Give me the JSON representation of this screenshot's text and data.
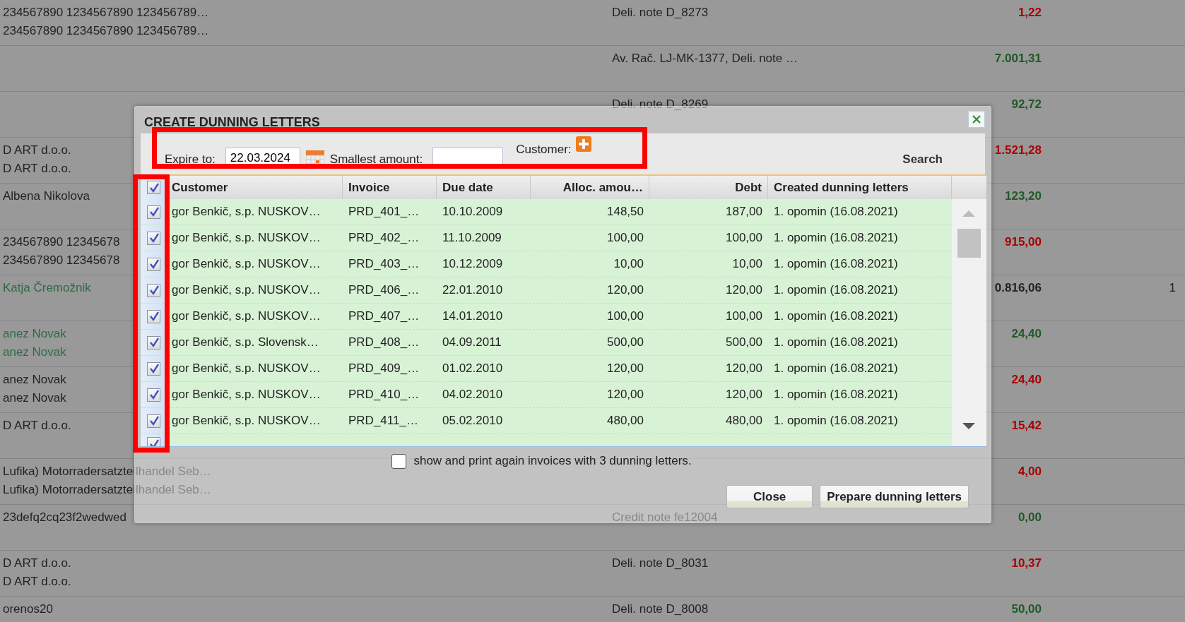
{
  "background": {
    "rows": [
      {
        "names": [
          "234567890 1234567890 123456789…",
          "234567890 1234567890 123456789…"
        ],
        "linked": false,
        "document": "Deli. note D_8273",
        "amount": "1,22",
        "color": "#a80000"
      },
      {
        "names": [],
        "document": "Av. Rač. LJ-MK-1377, Deli. note …",
        "amount": "7.001,31",
        "color": "#1f5a26"
      },
      {
        "names": [],
        "document": "Deli. note D_8269",
        "amount": "92,72",
        "color": "#1f5a26"
      },
      {
        "names": [
          "D ART d.o.o.",
          "D ART d.o.o."
        ],
        "linked": false,
        "amount": "1.521,28",
        "color": "#a80000"
      },
      {
        "names": [
          "Albena Nikolova"
        ],
        "linked": false,
        "amount": "123,20",
        "color": "#1f5a26"
      },
      {
        "names": [
          "234567890 12345678",
          "234567890 12345678"
        ],
        "linked": false,
        "amount": "915,00",
        "color": "#a80000"
      },
      {
        "names": [
          "Katja Čremožnik"
        ],
        "linked": true,
        "amount": "0.816,06",
        "color": "#222222",
        "extra": "1"
      },
      {
        "names": [
          "anez Novak",
          "anez Novak"
        ],
        "linked": true,
        "amount": "24,40",
        "color": "#1f5a26"
      },
      {
        "names": [
          "anez Novak",
          "anez Novak"
        ],
        "linked": false,
        "amount": "24,40",
        "color": "#a80000"
      },
      {
        "names": [
          "D ART d.o.o."
        ],
        "linked": false,
        "amount": "15,42",
        "color": "#a80000"
      },
      {
        "names": [
          "Lufika) Motorradersatzteilhandel Seb…",
          "Lufika) Motorradersatzteilhandel Seb…"
        ],
        "linked": false,
        "amount": "4,00",
        "color": "#a80000"
      },
      {
        "names": [
          "23defq2cq23f2wedwed"
        ],
        "linked": false,
        "document": "Credit note fe12004",
        "amount": "0,00",
        "color": "#1f5a26"
      },
      {
        "names": [
          "D ART d.o.o.",
          "D ART d.o.o."
        ],
        "linked": false,
        "document": "Deli. note D_8031",
        "amount": "10,37",
        "color": "#a80000"
      },
      {
        "names": [
          "orenos20"
        ],
        "linked": false,
        "document": "Deli. note D_8008",
        "amount": "50,00",
        "color": "#1f5a26"
      }
    ]
  },
  "modal": {
    "title": "CREATE DUNNING LETTERS",
    "filters": {
      "expire_label": "Expire to:",
      "expire_value": "22.03.2024",
      "amount_label": "Smallest amount:",
      "customer_label": "Customer:",
      "search_label": "Search",
      "highlighted": true
    },
    "table": {
      "all_checked": true,
      "checkbox_column_highlighted": true,
      "columns": [
        "Customer",
        "Invoice",
        "Due date",
        "Alloc. amou…",
        "Debt",
        "Created dunning letters"
      ],
      "rows": [
        {
          "checked": true,
          "cells": [
            "gor Benkič, s.p. NUSKOV…",
            "PRD_401_…",
            "10.10.2009",
            "148,50",
            "187,00",
            "1. opomin (16.08.2021)"
          ]
        },
        {
          "checked": true,
          "cells": [
            "gor Benkič, s.p. NUSKOV…",
            "PRD_402_…",
            "11.10.2009",
            "100,00",
            "100,00",
            "1. opomin (16.08.2021)"
          ]
        },
        {
          "checked": true,
          "cells": [
            "gor Benkič, s.p. NUSKOV…",
            "PRD_403_…",
            "10.12.2009",
            "10,00",
            "10,00",
            "1. opomin (16.08.2021)"
          ]
        },
        {
          "checked": true,
          "cells": [
            "gor Benkič, s.p. NUSKOV…",
            "PRD_406_…",
            "22.01.2010",
            "120,00",
            "120,00",
            "1. opomin (16.08.2021)"
          ]
        },
        {
          "checked": true,
          "cells": [
            "gor Benkič, s.p. NUSKOV…",
            "PRD_407_…",
            "14.01.2010",
            "100,00",
            "100,00",
            "1. opomin (16.08.2021)"
          ]
        },
        {
          "checked": true,
          "cells": [
            "gor Benkič, s.p. Slovensk…",
            "PRD_408_…",
            "04.09.2011",
            "500,00",
            "500,00",
            "1. opomin (16.08.2021)"
          ]
        },
        {
          "checked": true,
          "cells": [
            "gor Benkič, s.p. NUSKOV…",
            "PRD_409_…",
            "01.02.2010",
            "120,00",
            "120,00",
            "1. opomin (16.08.2021)"
          ]
        },
        {
          "checked": true,
          "cells": [
            "gor Benkič, s.p. NUSKOV…",
            "PRD_410_…",
            "04.02.2010",
            "120,00",
            "120,00",
            "1. opomin (16.08.2021)"
          ]
        },
        {
          "checked": true,
          "cells": [
            "gor Benkič, s.p. NUSKOV…",
            "PRD_411_…",
            "05.02.2010",
            "480,00",
            "480,00",
            "1. opomin (16.08.2021)"
          ]
        }
      ],
      "partial_row": {
        "checked": true
      }
    },
    "reprint_option": {
      "label": "show and print again invoices with 3 dunning letters.",
      "checked": false
    },
    "buttons": [
      "Close",
      "Prepare dunning letters"
    ]
  }
}
